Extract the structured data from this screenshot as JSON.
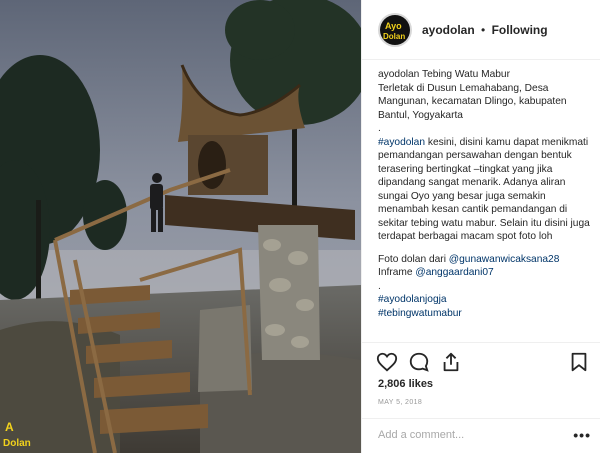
{
  "header": {
    "username": "ayodolan",
    "separator": "•",
    "follow_status": "Following"
  },
  "caption": {
    "username": "ayodolan",
    "line1": "Tebing Watu Mabur",
    "body": "Terletak di Dusun Lemahabang, Desa Mangunan, kecamatan Dlingo, kabupaten Bantul, Yogyakarta",
    "dot1": ".",
    "hashtag1": "#ayodolan",
    "hashtag1_text": " kesini, disini kamu dapat menikmati pemandangan persawahan dengan bentuk terasering bertingkat –tingkat yang jika dipandang sangat menarik. Adanya aliran sungai Oyo yang besar juga semakin menambah kesan cantik pemandangan di sekitar tebing watu mabur. Selain itu disini juga terdapat berbagai macam spot foto loh",
    "photo_credit_label": "Foto dolan dari ",
    "photo_credit_user": "@gunawanwicaksana28",
    "inframe_label": "Inframe ",
    "inframe_user": "@anggaardani07",
    "dot2": ".",
    "hashtag2": "#ayodolanjogja",
    "hashtag3": "#tebingwatumabur"
  },
  "actions": {
    "like": "heart-icon",
    "comment": "comment-icon",
    "share": "share-icon",
    "save": "bookmark-icon"
  },
  "likes": "2,806 likes",
  "date": "MAY 5, 2018",
  "comment": {
    "placeholder": "Add a comment...",
    "more": "•••"
  },
  "watermark": {
    "line1": "A",
    "line2": "Dolan"
  },
  "colors": {
    "link": "#003569",
    "border": "#efefef",
    "muted": "#999999",
    "logo_yellow": "#f2d21c"
  }
}
